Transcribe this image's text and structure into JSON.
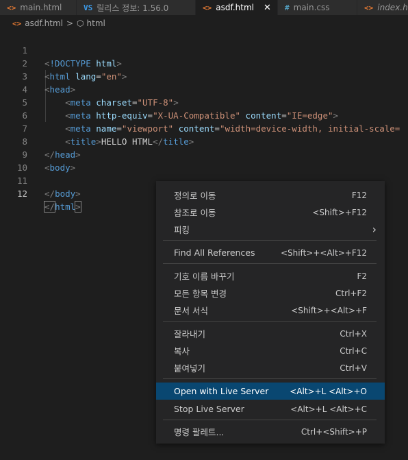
{
  "tabs": [
    {
      "icon": "<>",
      "label": "main.html",
      "active": false
    },
    {
      "icon": "VS",
      "label": "릴리스 정보: 1.56.0",
      "active": false
    },
    {
      "icon": "<>",
      "label": "asdf.html",
      "active": true,
      "close": "✕"
    },
    {
      "icon": "#",
      "label": "main.css",
      "active": false
    },
    {
      "icon": "<>",
      "label": "index.h",
      "active": false
    }
  ],
  "breadcrumb": {
    "file": "asdf.html",
    "separator": ">",
    "symbol": "html"
  },
  "lines": [
    "1",
    "2",
    "3",
    "4",
    "5",
    "6",
    "7",
    "8",
    "9",
    "10",
    "11",
    "12"
  ],
  "code": {
    "l1": {
      "open": "<",
      "doctype": "!DOCTYPE",
      "sp": " ",
      "html": "html",
      "close": ">"
    },
    "l2": {
      "lt": "<",
      "tag": "html",
      "attr": "lang",
      "eq": "=",
      "val": "\"en\"",
      "gt": ">"
    },
    "l3": {
      "lt": "<",
      "tag": "head",
      "gt": ">"
    },
    "l4": {
      "lt": "<",
      "tag": "meta",
      "attr": "charset",
      "eq": "=",
      "val": "\"UTF-8\"",
      "gt": ">"
    },
    "l5": {
      "lt": "<",
      "tag": "meta",
      "attr1": "http-equiv",
      "val1": "\"X-UA-Compatible\"",
      "attr2": "content",
      "val2": "\"IE=edge\"",
      "gt": ">"
    },
    "l6": {
      "lt": "<",
      "tag": "meta",
      "attr1": "name",
      "val1": "\"viewport\"",
      "attr2": "content",
      "val2": "\"width=device-width, initial-scale="
    },
    "l7": {
      "lt": "<",
      "tag": "title",
      "gt": ">",
      "text": "HELLO HTML",
      "lt2": "</",
      "tag2": "title"
    },
    "l8": {
      "lt": "</",
      "tag": "head",
      "gt": ">"
    },
    "l9": {
      "lt": "<",
      "tag": "body",
      "gt": ">"
    },
    "l11": {
      "lt": "</",
      "tag": "body",
      "gt": ">"
    },
    "l12": {
      "lt": "</",
      "tag": "html",
      "gt": ">"
    }
  },
  "menu": {
    "go_to_definition": {
      "label": "정의로 이동",
      "kb": "F12"
    },
    "go_to_references": {
      "label": "참조로 이동",
      "kb": "<Shift>+F12"
    },
    "peek": {
      "label": "피킹",
      "kb": "›"
    },
    "find_all_references": {
      "label": "Find All References",
      "kb": "<Shift>+<Alt>+F12"
    },
    "rename_symbol": {
      "label": "기호 이름 바꾸기",
      "kb": "F2"
    },
    "change_all": {
      "label": "모든 항목 변경",
      "kb": "Ctrl+F2"
    },
    "format_document": {
      "label": "문서 서식",
      "kb": "<Shift>+<Alt>+F"
    },
    "cut": {
      "label": "잘라내기",
      "kb": "Ctrl+X"
    },
    "copy": {
      "label": "복사",
      "kb": "Ctrl+C"
    },
    "paste": {
      "label": "붙여넣기",
      "kb": "Ctrl+V"
    },
    "open_live_server": {
      "label": "Open with Live Server",
      "kb": "<Alt>+L <Alt>+O"
    },
    "stop_live_server": {
      "label": "Stop Live Server",
      "kb": "<Alt>+L <Alt>+C"
    },
    "command_palette": {
      "label": "명령 팔레트...",
      "kb": "Ctrl+<Shift>+P"
    }
  },
  "colors": {
    "accent": "#094771",
    "tag": "#569cd6",
    "attr": "#9cdcfe",
    "string": "#ce9178"
  }
}
